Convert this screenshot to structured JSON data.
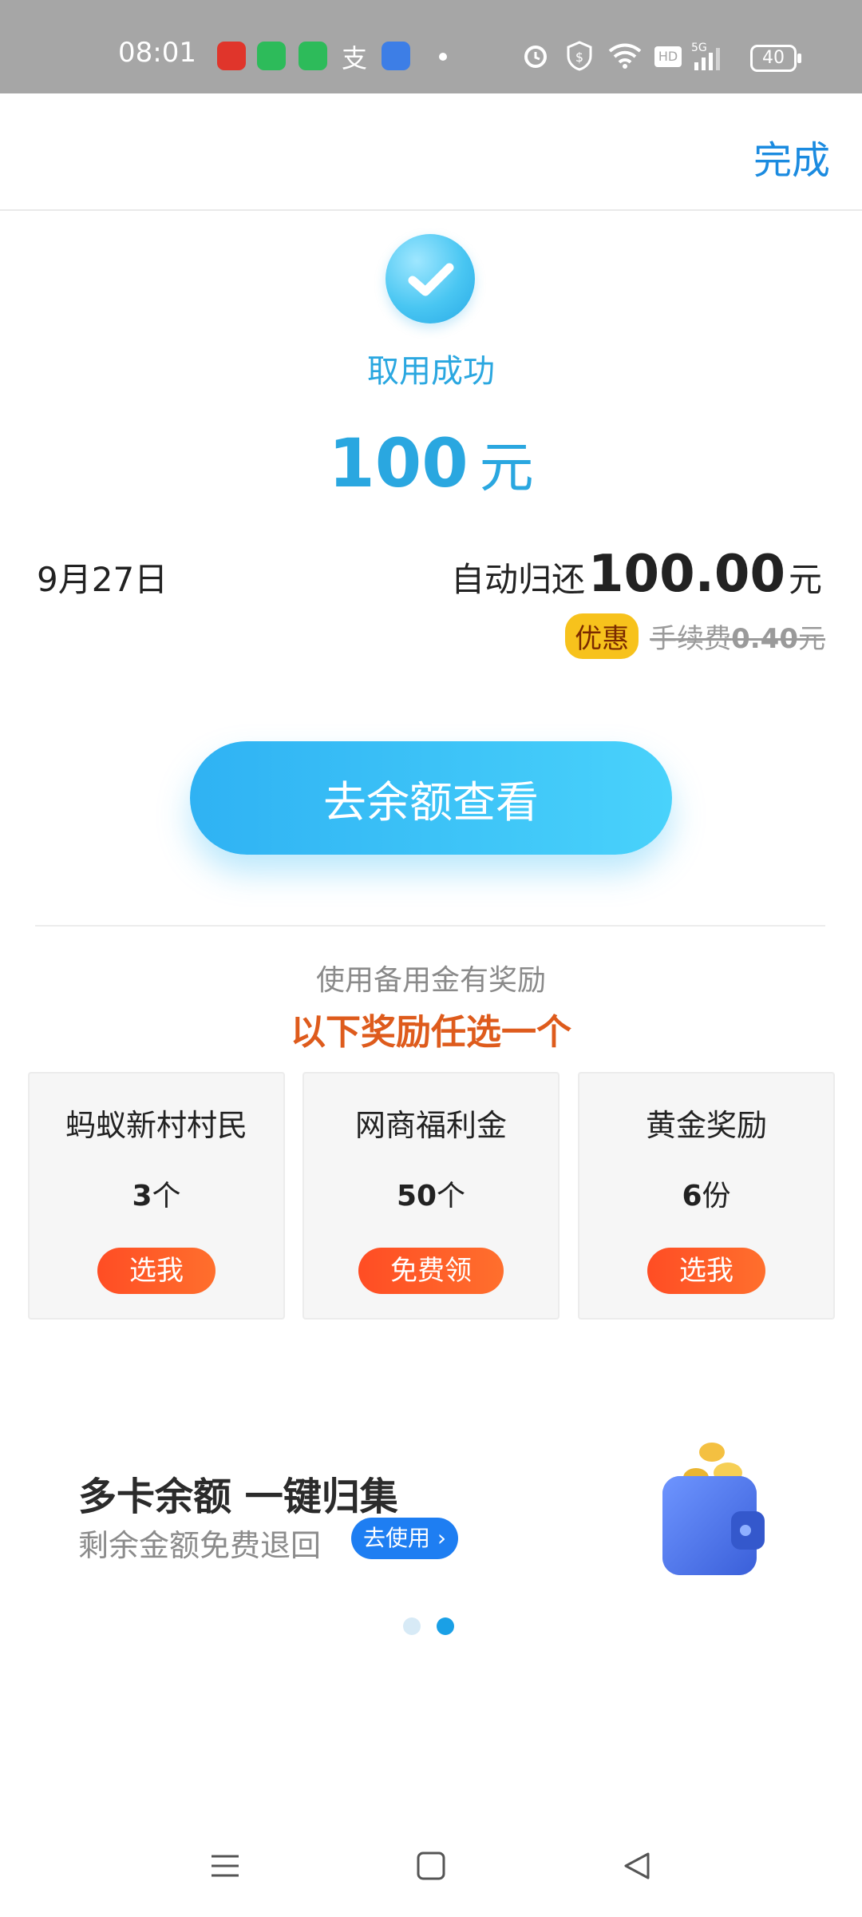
{
  "statusbar": {
    "time": "08:01",
    "battery": "40",
    "icons": [
      "toutiao-app-icon",
      "green-app-icon",
      "green-a-app-icon",
      "alipay-icon",
      "chat-bubble-icon",
      "dot",
      "alarm-icon",
      "shield-dollar-icon",
      "wifi-icon",
      "hd-icon",
      "signal-5g-icon"
    ]
  },
  "header": {
    "done_label": "完成"
  },
  "result": {
    "title": "取用成功",
    "amount": "100",
    "amount_unit": "元"
  },
  "repayment": {
    "date": "9月27日",
    "prefix": "自动归还",
    "amount": "100.00",
    "unit": "元",
    "badge": "优惠",
    "fee_label": "手续费",
    "fee_amount": "0.40",
    "fee_unit": "元"
  },
  "cta": {
    "label": "去余额查看"
  },
  "rewards": {
    "subtitle": "使用备用金有奖励",
    "title": "以下奖励任选一个",
    "items": [
      {
        "name": "蚂蚁新村村民",
        "qty": "3",
        "qty_unit": "个",
        "button": "选我"
      },
      {
        "name": "网商福利金",
        "qty": "50",
        "qty_unit": "个",
        "button": "免费领"
      },
      {
        "name": "黄金奖励",
        "qty": "6",
        "qty_unit": "份",
        "button": "选我"
      }
    ]
  },
  "banner": {
    "title": "多卡余额 一键归集",
    "subtitle": "剩余金额免费退回",
    "button": "去使用 ›"
  },
  "carousel": {
    "dots": 2,
    "active": 2
  },
  "colors": {
    "accent": "#2aa7e0",
    "done": "#1b8be0",
    "reward_title": "#de5b1c",
    "cta_gradient_start": "#2fb2f3",
    "cta_gradient_end": "#49d2fb",
    "button_orange": "#ff4d24",
    "badge": "#f7c21c"
  }
}
